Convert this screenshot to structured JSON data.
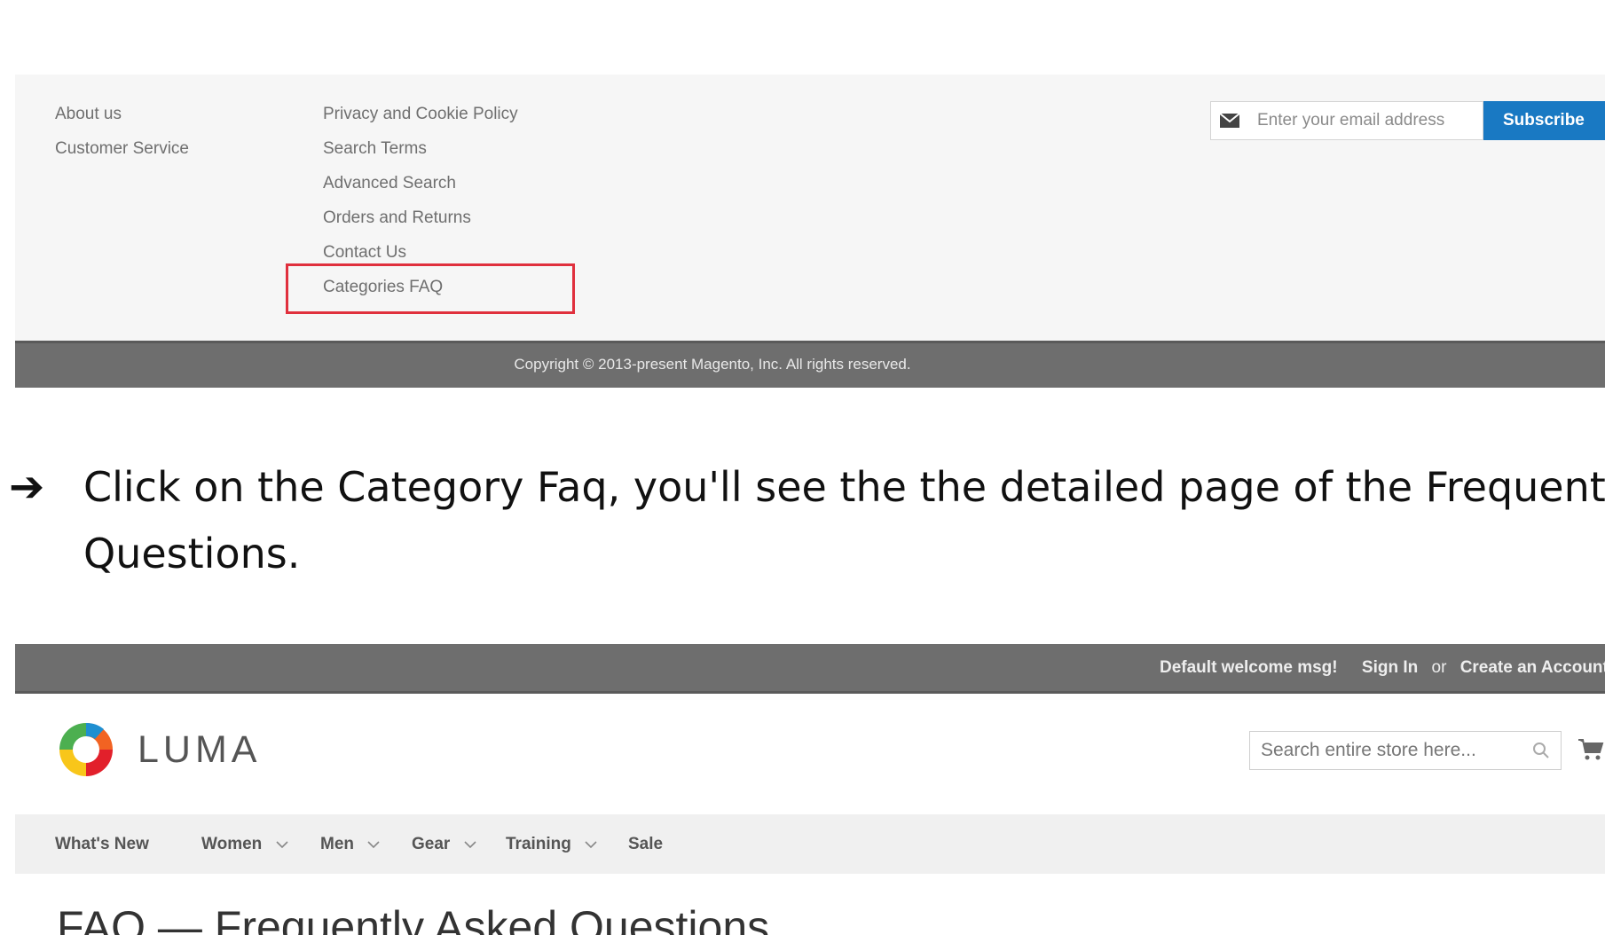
{
  "footer": {
    "col1": [
      "About us",
      "Customer Service"
    ],
    "col2": [
      "Privacy and Cookie Policy",
      "Search Terms",
      "Advanced Search",
      "Orders and Returns",
      "Contact Us",
      "Categories FAQ"
    ],
    "newsletter": {
      "placeholder": "Enter your email address",
      "button_label": "Subscribe",
      "icon": "envelope-icon"
    },
    "copyright": "Copyright © 2013-present Magento, Inc. All rights reserved."
  },
  "instruction": {
    "arrow": "➔",
    "line1": "Click on the Category Faq, you'll see the the detailed page of the Frequently A",
    "line2": "Questions."
  },
  "luma": {
    "topbar": {
      "welcome": "Default welcome msg!",
      "sign_in": "Sign In",
      "or": "or",
      "create_account": "Create an Account"
    },
    "logo_text": "LUMA",
    "search_placeholder": "Search entire store here...",
    "nav": [
      {
        "label": "What's New",
        "dropdown": false
      },
      {
        "label": "Women",
        "dropdown": true
      },
      {
        "label": "Men",
        "dropdown": true
      },
      {
        "label": "Gear",
        "dropdown": true
      },
      {
        "label": "Training",
        "dropdown": true
      },
      {
        "label": "Sale",
        "dropdown": false
      }
    ],
    "page_title": "FAQ — Frequently Asked Questions"
  },
  "colors": {
    "highlight": "#e0303d",
    "subscribe": "#1979c3",
    "bar": "#6e6e6e"
  }
}
